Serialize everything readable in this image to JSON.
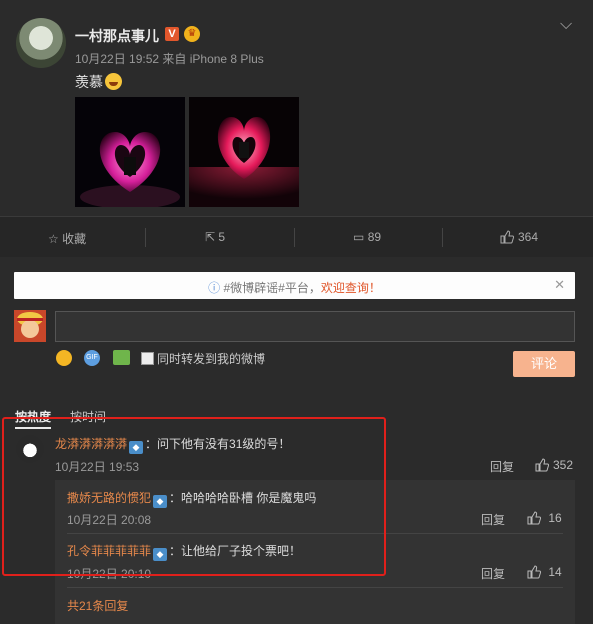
{
  "post": {
    "author": "一村那点事儿",
    "verified_badge": "V",
    "meta": "10月22日 19:52 来自 iPhone 8 Plus",
    "text": "羡慕",
    "emoji": "laugh-emoji"
  },
  "actions": {
    "favorite_label": "收藏",
    "repost_count": "5",
    "comment_count": "89",
    "like_count": "364"
  },
  "notice": {
    "prefix": "#微博辟谣#平台，",
    "link": "欢迎查询！"
  },
  "composer": {
    "repost_checkbox_label": "同时转发到我的微博",
    "submit_label": "评论",
    "gif_label": "GIF"
  },
  "tabs": {
    "hot": "按热度",
    "time": "按时间"
  },
  "comments": [
    {
      "name": "龙漭漭漭漭漭",
      "text": "：问下他有没有31级的号！",
      "time": "10月22日 19:53",
      "reply_label": "回复",
      "likes": "352"
    }
  ],
  "replies": [
    {
      "name": "撒娇无路的惯犯",
      "text": "：哈哈哈哈卧槽 你是魔鬼吗",
      "time": "10月22日 20:08",
      "reply_label": "回复",
      "likes": "16"
    },
    {
      "name": "孔令菲菲菲菲菲",
      "text": "：让他给厂子投个票吧！",
      "time": "10月22日 20:10",
      "reply_label": "回复",
      "likes": "14"
    }
  ],
  "more_replies": "共21条回复",
  "colors": {
    "accent": "#e6884b",
    "highlight_box": "#e0201b",
    "submit": "#f7b38e"
  }
}
